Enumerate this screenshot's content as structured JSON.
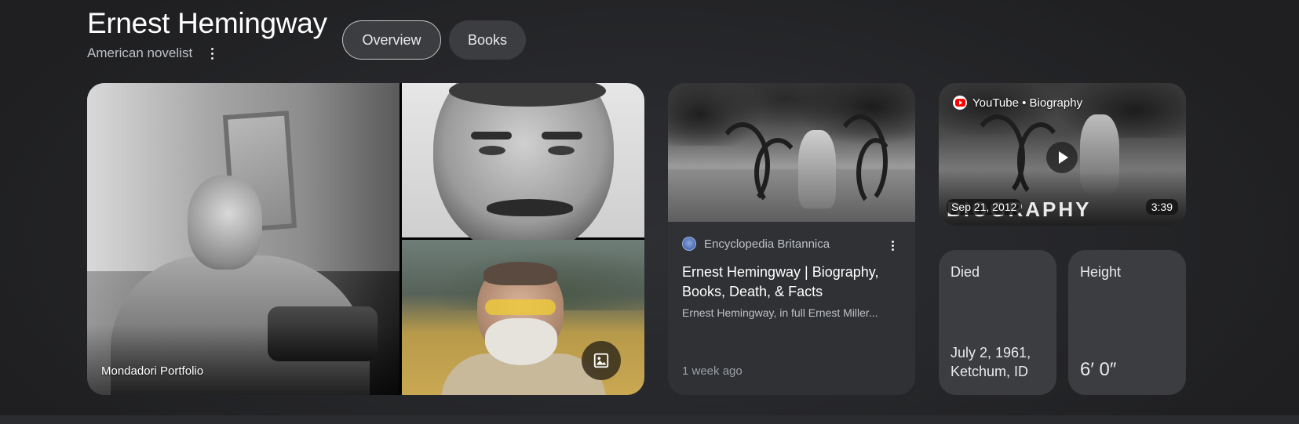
{
  "header": {
    "title": "Ernest Hemingway",
    "subtitle": "American novelist",
    "tabs": [
      {
        "label": "Overview",
        "selected": true
      },
      {
        "label": "Books",
        "selected": false
      }
    ]
  },
  "images": {
    "main_caption": "Mondadori Portfolio",
    "gallery_icon": "image-gallery-icon"
  },
  "article": {
    "source": "Encyclopedia Britannica",
    "title": "Ernest Hemingway | Biography, Books, Death, & Facts",
    "snippet": "Ernest Hemingway, in full Ernest Miller...",
    "time": "1 week ago"
  },
  "video": {
    "source": "YouTube • Biography",
    "overlay_text": "BIOGRAPHY",
    "date": "Sep 21, 2012",
    "duration": "3:39"
  },
  "facts": [
    {
      "label": "Died",
      "value": "July 2, 1961, Ketchum, ID"
    },
    {
      "label": "Height",
      "value": "6′ 0″"
    }
  ],
  "colors": {
    "background": "#1f1f21",
    "card": "#303134",
    "fact_card": "#3c3d41",
    "chip_border": "#c4c7c5",
    "youtube_red": "#ff0000"
  }
}
